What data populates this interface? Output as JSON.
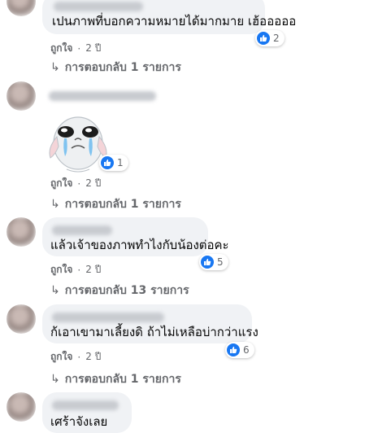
{
  "comments": [
    {
      "text": "เปนภาพที่บอกความหมายได้มากมาย เฮ้อออออ",
      "reactions": "2",
      "like_label": "ถูกใจ",
      "separator": "·",
      "time": "2 ปี",
      "replies_label": "การตอบกลับ 1 รายการ"
    },
    {
      "sticker": "crying-bunny-sticker",
      "reactions": "1",
      "like_label": "ถูกใจ",
      "separator": "·",
      "time": "2 ปี",
      "replies_label": "การตอบกลับ 1 รายการ"
    },
    {
      "text": "แล้วเจ้าของภาพทำไงกับน้องต่อคะ",
      "reactions": "5",
      "like_label": "ถูกใจ",
      "separator": "·",
      "time": "2 ปี",
      "replies_label": "การตอบกลับ 13 รายการ"
    },
    {
      "text": "ก้เอาเขามาเลี้ยงดิ ถ้าไม่เหลือบ่ากว่าแรง",
      "reactions": "6",
      "like_label": "ถูกใจ",
      "separator": "·",
      "time": "2 ปี",
      "replies_label": "การตอบกลับ 1 รายการ"
    },
    {
      "text": "เศร้าจังเลย"
    }
  ],
  "colors": {
    "accent": "#1877f2",
    "bubble": "#f0f2f5",
    "muted_text": "#65676b"
  }
}
